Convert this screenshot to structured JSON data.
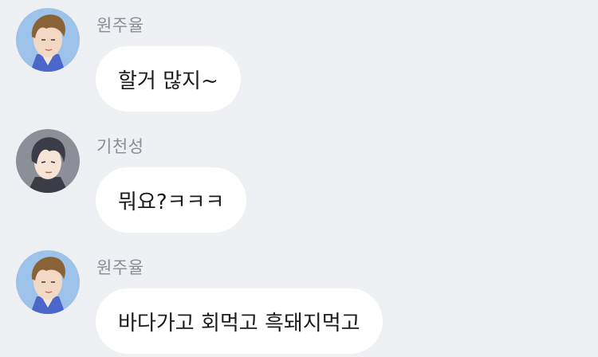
{
  "messages": [
    {
      "sender": "원주율",
      "text": "할거 많지~",
      "avatar": "boy-brown-hair-avatar"
    },
    {
      "sender": "기천성",
      "text": "뭐요?ㅋㅋㅋ",
      "avatar": "boy-dark-hair-avatar"
    },
    {
      "sender": "원주율",
      "text": "바다가고 회먹고 흑돼지먹고",
      "avatar": "boy-brown-hair-avatar"
    }
  ],
  "colors": {
    "background": "#eef0f3",
    "bubble": "#ffffff",
    "sender_text": "#8a8d92",
    "message_text": "#1c1c1c"
  }
}
